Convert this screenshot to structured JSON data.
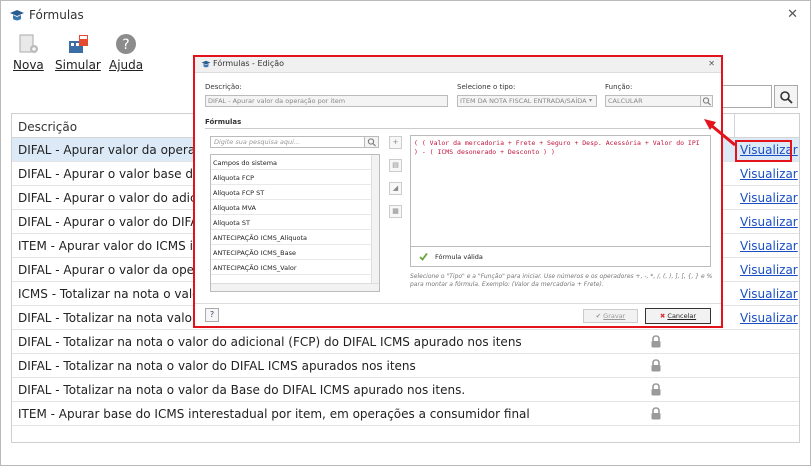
{
  "window": {
    "title": "Fórmulas",
    "close": "✕"
  },
  "toolbar": {
    "nova": "Nova",
    "simular": "Simular",
    "ajuda": "Ajuda"
  },
  "grid": {
    "header": "Descrição",
    "link_label": "Visualizar",
    "rows": [
      {
        "text": "DIFAL - Apurar valor da operação p",
        "lock": false,
        "link": true
      },
      {
        "text": "DIFAL - Apurar o valor base dupla c",
        "lock": false,
        "link": true
      },
      {
        "text": "DIFAL - Apurar o valor do adicional",
        "lock": false,
        "link": true
      },
      {
        "text": "DIFAL - Apurar o valor do DIFAL ICM",
        "lock": false,
        "link": true
      },
      {
        "text": "ITEM - Apurar valor do ICMS interes",
        "lock": false,
        "link": true
      },
      {
        "text": "DIFAL - Apurar o valor da operação",
        "lock": false,
        "link": true
      },
      {
        "text": "ICMS - Totalizar na nota o valor do",
        "lock": false,
        "link": true
      },
      {
        "text": "DIFAL - Totalizar na nota valor da o",
        "lock": false,
        "link": true
      },
      {
        "text": "DIFAL - Totalizar na nota o valor do adicional (FCP) do DIFAL ICMS apurado nos itens",
        "lock": true,
        "link": false
      },
      {
        "text": "DIFAL - Totalizar na nota o valor do DIFAL ICMS apurados nos itens",
        "lock": true,
        "link": false
      },
      {
        "text": "DIFAL - Totalizar na nota o valor da Base do DIFAL ICMS apurado nos itens.",
        "lock": true,
        "link": false
      },
      {
        "text": "ITEM - Apurar base do ICMS interestadual por item, em operações a consumidor final",
        "lock": true,
        "link": false
      }
    ]
  },
  "modal": {
    "title": "Fórmulas - Edição",
    "close": "✕",
    "descricao_label": "Descrição:",
    "descricao_value": "DIFAL - Apurar valor da operação por item",
    "tipo_label": "Selecione o tipo:",
    "tipo_value": "ITEM DA NOTA FISCAL ENTRADA/SAÍDA",
    "funcao_label": "Função:",
    "funcao_value": "CALCULAR",
    "section": "Fórmulas",
    "search_placeholder": "Digite sua pesquisa aqui...",
    "list_header": "Campos do sistema",
    "list_items": [
      "Alíquota FCP",
      "Alíquota FCP ST",
      "Alíquota MVA",
      "Alíquota ST",
      "ANTECIPAÇÃO ICMS_Alíquota",
      "ANTECIPAÇÃO ICMS_Base",
      "ANTECIPAÇÃO ICMS_Valor"
    ],
    "formula": "( ( Valor da mercadoria + Frete + Seguro + Desp. Acessória + Valor do IPI ) - ( ICMS desonerado + Desconto ) )",
    "valid_text": "Fórmula válida",
    "hint": "Selecione o \"Tipo\" e a \"Função\" para iniciar. Use números e os operadores +, -, *, /, (, ), ], [, {, } e % para montar a fórmula. Exemplo: (Valor da mercadoria + Frete).",
    "help": "?",
    "gravar": "Gravar",
    "cancelar": "Cancelar"
  },
  "colors": {
    "highlight": "#e3121b",
    "link": "#1a4fc4",
    "formula": "#c0143c"
  }
}
